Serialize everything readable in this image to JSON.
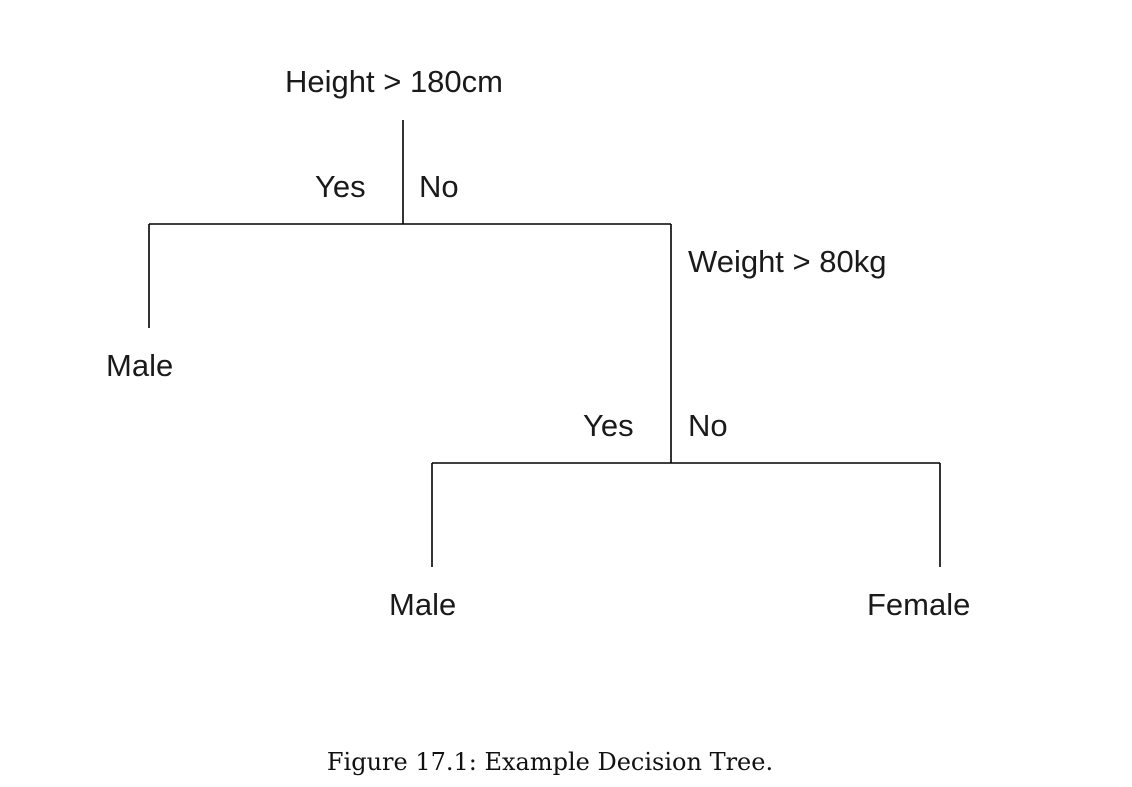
{
  "tree": {
    "root": {
      "condition": "Height > 180cm",
      "yes_label": "Yes",
      "no_label": "No",
      "yes_outcome": "Male"
    },
    "weight_node": {
      "condition": "Weight > 80kg",
      "yes_label": "Yes",
      "no_label": "No",
      "yes_outcome": "Male",
      "no_outcome": "Female"
    }
  },
  "caption": "Figure 17.1: Example Decision Tree."
}
